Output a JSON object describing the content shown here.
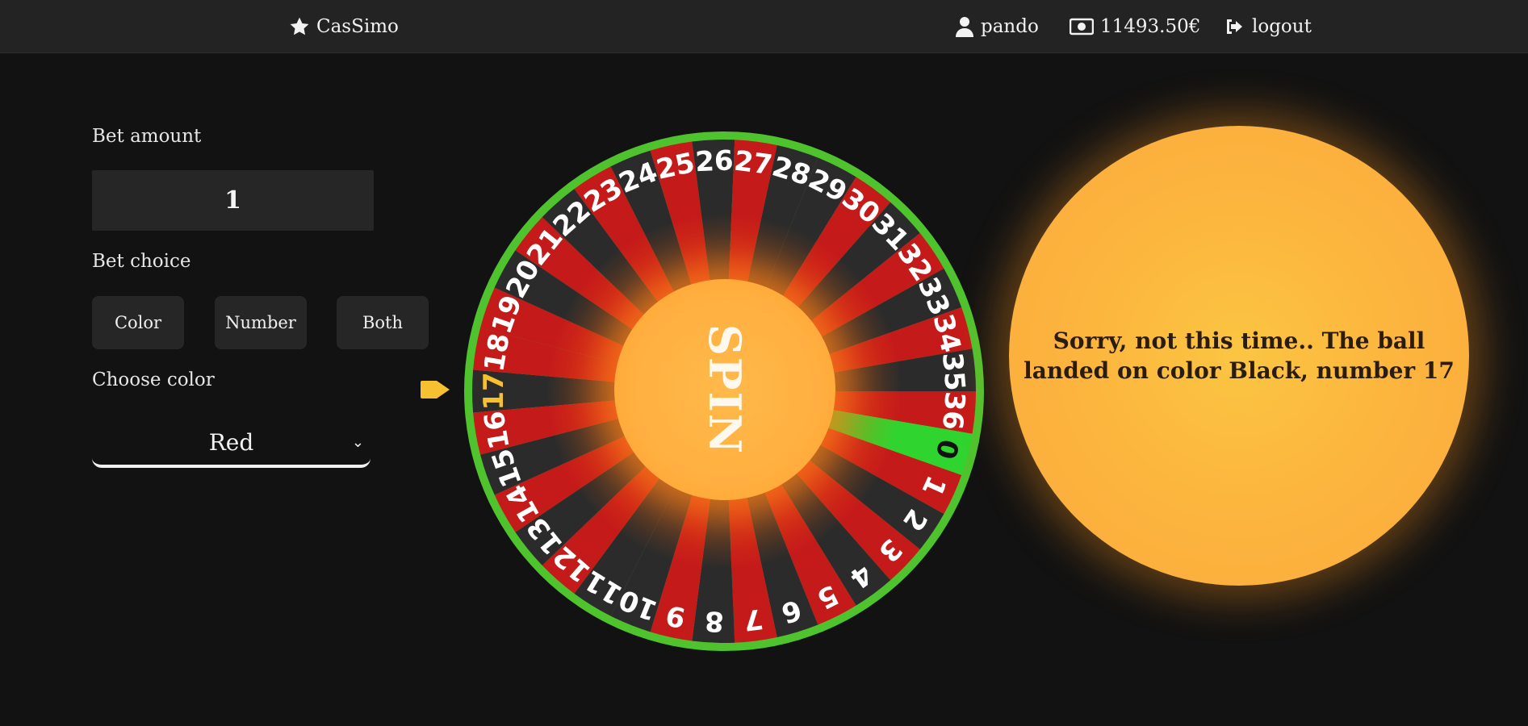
{
  "nav": {
    "brand": "CasSimo",
    "username": "pando",
    "balance": "11493.50€",
    "logout": "logout"
  },
  "form": {
    "bet_amount_label": "Bet amount",
    "bet_amount_value": "1",
    "bet_choice_label": "Bet choice",
    "choices": [
      "Color",
      "Number",
      "Both"
    ],
    "choose_color_label": "Choose color",
    "selected_color": "Red"
  },
  "wheel": {
    "spin_label": "SPIN",
    "numbers": [
      17,
      18,
      19,
      20,
      21,
      22,
      23,
      24,
      25,
      26,
      27,
      28,
      29,
      30,
      31,
      32,
      33,
      34,
      35,
      36,
      0,
      1,
      2,
      3,
      4,
      5,
      6,
      7,
      8,
      9,
      10,
      11,
      12,
      13,
      14,
      15,
      16
    ],
    "highlighted_number": 17,
    "colors": {
      "red": "#c41a1a",
      "black": "#2b2b2b",
      "green": "#2fd42f",
      "rim": "#4ec32e",
      "highlight": "#f5c131"
    }
  },
  "result": {
    "message": "Sorry, not this time.. The ball landed on color Black, number 17"
  }
}
